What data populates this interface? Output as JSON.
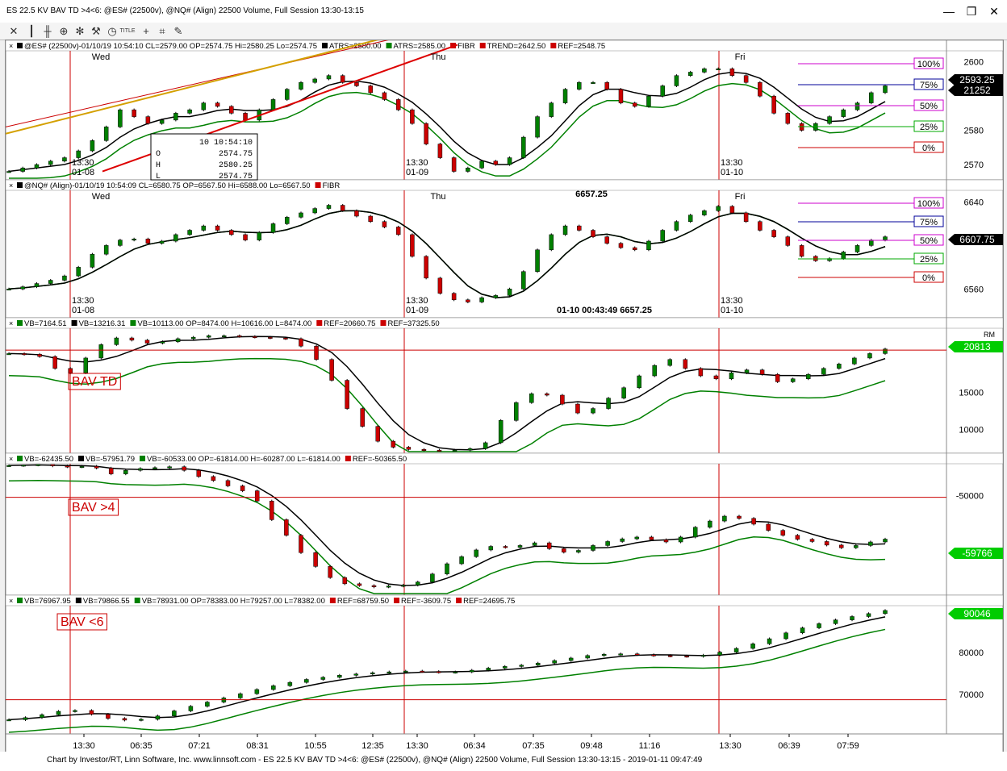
{
  "window": {
    "title": "ES 22.5 KV BAV TD >4<6: @ES# (22500v), @NQ# (Align) 22500 Volume, Full Session 13:30-13:15",
    "controls": [
      "—",
      "❐",
      "✕"
    ]
  },
  "toolbar": {
    "icons": [
      "close-x-icon",
      "bars-icon",
      "candles-icon",
      "zoom-icon",
      "gear-icon",
      "wrench-icon",
      "clock-icon",
      "title-icon",
      "crosshair-icon",
      "draw-icon",
      "pencil-icon"
    ],
    "title_label": "TITLE"
  },
  "panels": [
    {
      "id": "es",
      "legend": [
        {
          "text": "@ES# (22500v)-01/10/19 10:54:10 CL=2579.00 OP=2574.75 Hi=2580.25 Lo=2574.75",
          "color": "#000000"
        },
        {
          "text": "ATRS=2580.00",
          "color": "#000000"
        },
        {
          "text": "ATRS=2585.00",
          "color": "#008000"
        },
        {
          "text": "FIBR",
          "color": "#cc0000"
        },
        {
          "text": "TREND=2642.50",
          "color": "#cc0000"
        },
        {
          "text": "REF=2548.75",
          "color": "#cc0000"
        }
      ],
      "day_labels": [
        "Wed",
        "Thu",
        "Fri"
      ],
      "axis_ticks": [
        "2600",
        "2580",
        "2570"
      ],
      "fib_levels": [
        "100%",
        "75%",
        "50%",
        "25%",
        "0%"
      ],
      "price_tags": [
        {
          "text": "2593.25",
          "bg": "#000000",
          "fg": "#ffffff"
        },
        {
          "text": "21252",
          "bg": "#000000",
          "fg": "#ffffff"
        }
      ],
      "session_labels": [
        [
          "13:30",
          "01-08"
        ],
        [
          "13:30",
          "01-09"
        ],
        [
          "13:30",
          "01-10"
        ]
      ],
      "data_box": {
        "rows": [
          [
            "",
            "10 10:54:10"
          ],
          [
            "O",
            "2574.75"
          ],
          [
            "H",
            "2580.25"
          ],
          [
            "L",
            "2574.75"
          ]
        ]
      }
    },
    {
      "id": "nq",
      "legend": [
        {
          "text": "@NQ# (Align)-01/10/19 10:54:09 CL=6580.75 OP=6567.50 Hi=6588.00 Lo=6567.50",
          "color": "#000000"
        },
        {
          "text": "FIBR",
          "color": "#cc0000"
        }
      ],
      "day_labels": [
        "Wed",
        "Thu",
        "Fri"
      ],
      "axis_ticks": [
        "6640",
        "6560"
      ],
      "fib_levels": [
        "100%",
        "75%",
        "50%",
        "25%",
        "0%"
      ],
      "price_tags": [
        {
          "text": "6607.75",
          "bg": "#000000",
          "fg": "#ffffff"
        }
      ],
      "session_labels": [
        [
          "13:30",
          "01-08"
        ],
        [
          "13:30",
          "01-09"
        ],
        [
          "13:30",
          "01-10"
        ]
      ],
      "annotations": [
        "6657.25",
        "01-10 00:43:49  6657.25"
      ]
    },
    {
      "id": "bav_td",
      "legend": [
        {
          "text": "VB=7164.51",
          "color": "#008000"
        },
        {
          "text": "VB=13216.31",
          "color": "#000000"
        },
        {
          "text": "VB=10113.00 OP=8474.00 H=10616.00 L=8474.00",
          "color": "#008000"
        },
        {
          "text": "REF=20660.75",
          "color": "#cc0000"
        },
        {
          "text": "REF=37325.50",
          "color": "#cc0000"
        }
      ],
      "label": "BAV TD",
      "axis_ticks": [
        "15000",
        "10000"
      ],
      "price_tags": [
        {
          "text": "20813",
          "bg": "#00cc00",
          "fg": "#ffffff"
        }
      ],
      "corner_label": "RM"
    },
    {
      "id": "bav_gt4",
      "legend": [
        {
          "text": "VB=-62435.50",
          "color": "#008000"
        },
        {
          "text": "VB=-57951.79",
          "color": "#000000"
        },
        {
          "text": "VB=-60533.00 OP=-61814.00 H=-60287.00 L=-61814.00",
          "color": "#008000"
        },
        {
          "text": "REF=-50365.50",
          "color": "#cc0000"
        }
      ],
      "label": "BAV >4",
      "axis_ticks": [
        "-50000"
      ],
      "price_tags": [
        {
          "text": "-59766",
          "bg": "#00cc00",
          "fg": "#ffffff"
        }
      ]
    },
    {
      "id": "bav_lt6",
      "legend": [
        {
          "text": "VB=76967.95",
          "color": "#008000"
        },
        {
          "text": "VB=79866.55",
          "color": "#000000"
        },
        {
          "text": "VB=78931.00 OP=78383.00 H=79257.00 L=78382.00",
          "color": "#008000"
        },
        {
          "text": "REF=68759.50",
          "color": "#cc0000"
        },
        {
          "text": "REF=-3609.75",
          "color": "#cc0000"
        },
        {
          "text": "REF=24695.75",
          "color": "#cc0000"
        }
      ],
      "label": "BAV <6",
      "axis_ticks": [
        "80000",
        "70000"
      ],
      "price_tags": [
        {
          "text": "90046",
          "bg": "#00cc00",
          "fg": "#ffffff"
        }
      ]
    }
  ],
  "time_axis": [
    "13:30",
    "06:35",
    "07:21",
    "08:31",
    "10:55",
    "12:35",
    "13:30",
    "06:34",
    "07:35",
    "09:48",
    "11:16",
    "13:30",
    "06:39",
    "07:59"
  ],
  "status": "Chart by Investor/RT, Linn Software, Inc. www.linnsoft.com - ES 22.5 KV BAV TD >4<6: @ES# (22500v), @NQ# (Align) 22500 Volume, Full Session 13:30-13:15 - 2019-01-11 09:47:49",
  "colors": {
    "up": "#008000",
    "down": "#cc0000",
    "fib_magenta": "#cc00cc",
    "fib_blue": "#000099",
    "fib_green": "#00aa00",
    "fib_red": "#cc0000",
    "ref": "#cc0000"
  },
  "chart_data": [
    {
      "type": "candlestick",
      "title": "@ES# (22500v)",
      "ylim": [
        2566,
        2603
      ],
      "yticks": [
        2600,
        2580,
        2570
      ],
      "trend_path": [
        [
          0.28,
          2578
        ],
        [
          0.0,
          2603
        ]
      ],
      "series": [
        {
          "values": [
            2568,
            2569,
            2570,
            2571,
            2572,
            2574,
            2577,
            2581,
            2586,
            2584,
            2582,
            2583,
            2585,
            2586,
            2588,
            2587,
            2585,
            2583,
            2586,
            2589,
            2592,
            2594,
            2595,
            2596,
            2594,
            2593,
            2591,
            2589,
            2586,
            2582,
            2576,
            2572,
            2568,
            2569,
            2571,
            2570,
            2572,
            2578,
            2584,
            2588,
            2592,
            2594,
            2594,
            2592,
            2588,
            2587,
            2590,
            2593,
            2596,
            2597,
            2598,
            2598,
            2596,
            2594,
            2590,
            2585,
            2582,
            2580,
            2582,
            2584,
            2586,
            2588,
            2591,
            2593
          ]
        }
      ]
    },
    {
      "type": "candlestick",
      "title": "@NQ# (Align)",
      "ylim": [
        6535,
        6650
      ],
      "yticks": [
        6640,
        6560
      ],
      "series": [
        {
          "values": [
            6560,
            6562,
            6565,
            6568,
            6572,
            6580,
            6592,
            6600,
            6605,
            6606,
            6602,
            6604,
            6610,
            6614,
            6618,
            6614,
            6610,
            6605,
            6612,
            6620,
            6626,
            6630,
            6634,
            6637,
            6632,
            6627,
            6622,
            6617,
            6610,
            6590,
            6570,
            6556,
            6550,
            6548,
            6552,
            6554,
            6560,
            6576,
            6596,
            6610,
            6618,
            6614,
            6608,
            6602,
            6598,
            6596,
            6604,
            6614,
            6622,
            6628,
            6632,
            6636,
            6630,
            6622,
            6614,
            6608,
            6600,
            6590,
            6586,
            6588,
            6594,
            6600,
            6605,
            6608
          ]
        }
      ]
    },
    {
      "type": "candlestick",
      "title": "BAV TD",
      "ylim": [
        7000,
        23500
      ],
      "yticks": [
        15000,
        10000
      ],
      "ref": [
        20660.75,
        37325.5
      ],
      "series": [
        {
          "values": [
            20200,
            20100,
            19800,
            18200,
            17600,
            19600,
            21400,
            22300,
            22000,
            21600,
            21800,
            22200,
            22400,
            22600,
            22600,
            22500,
            22400,
            22300,
            22200,
            21200,
            19400,
            16600,
            12800,
            10400,
            8400,
            7600,
            7300,
            7200,
            7100,
            7200,
            7400,
            8200,
            11200,
            13600,
            14800,
            14600,
            13400,
            12200,
            12800,
            14200,
            15600,
            17200,
            18600,
            19400,
            18200,
            17200,
            16800,
            17600,
            18000,
            17400,
            16400,
            16800,
            17400,
            18200,
            18800,
            19600,
            20200,
            20813
          ]
        }
      ]
    },
    {
      "type": "candlestick",
      "title": "BAV >4",
      "ylim": [
        -72000,
        -43000
      ],
      "yticks": [
        -50000
      ],
      "ref": [
        -50365.5
      ],
      "series": [
        {
          "values": [
            -43200,
            -43100,
            -43000,
            -43300,
            -43500,
            -43400,
            -43800,
            -45100,
            -44300,
            -43900,
            -43700,
            -43500,
            -44300,
            -45700,
            -46600,
            -47800,
            -48900,
            -51200,
            -55400,
            -58900,
            -62800,
            -65900,
            -68400,
            -69800,
            -70200,
            -70500,
            -70300,
            -70100,
            -69400,
            -67600,
            -65300,
            -63700,
            -62200,
            -61400,
            -61600,
            -61200,
            -60600,
            -61900,
            -62700,
            -62300,
            -61200,
            -60300,
            -59700,
            -59300,
            -59900,
            -60400,
            -59300,
            -57100,
            -55700,
            -54600,
            -55100,
            -56400,
            -57800,
            -58900,
            -59800,
            -60300,
            -61100,
            -61700,
            -61200,
            -60400,
            -59766
          ]
        }
      ]
    },
    {
      "type": "candlestick",
      "title": "BAV <6",
      "ylim": [
        61000,
        91000
      ],
      "yticks": [
        80000,
        70000
      ],
      "ref": [
        68759.5
      ],
      "series": [
        {
          "values": [
            64000,
            64500,
            65200,
            66000,
            66200,
            65300,
            64300,
            63900,
            64100,
            64900,
            66100,
            67200,
            68200,
            69200,
            70200,
            71200,
            72100,
            72900,
            73600,
            74100,
            74600,
            74900,
            75200,
            75400,
            75600,
            75500,
            75300,
            75400,
            75800,
            76300,
            76700,
            77000,
            77500,
            78100,
            78700,
            79300,
            79600,
            79700,
            79500,
            79300,
            79200,
            79100,
            79400,
            80100,
            81000,
            82100,
            83300,
            84700,
            85900,
            86900,
            87800,
            88600,
            89300,
            90046
          ]
        }
      ]
    }
  ]
}
